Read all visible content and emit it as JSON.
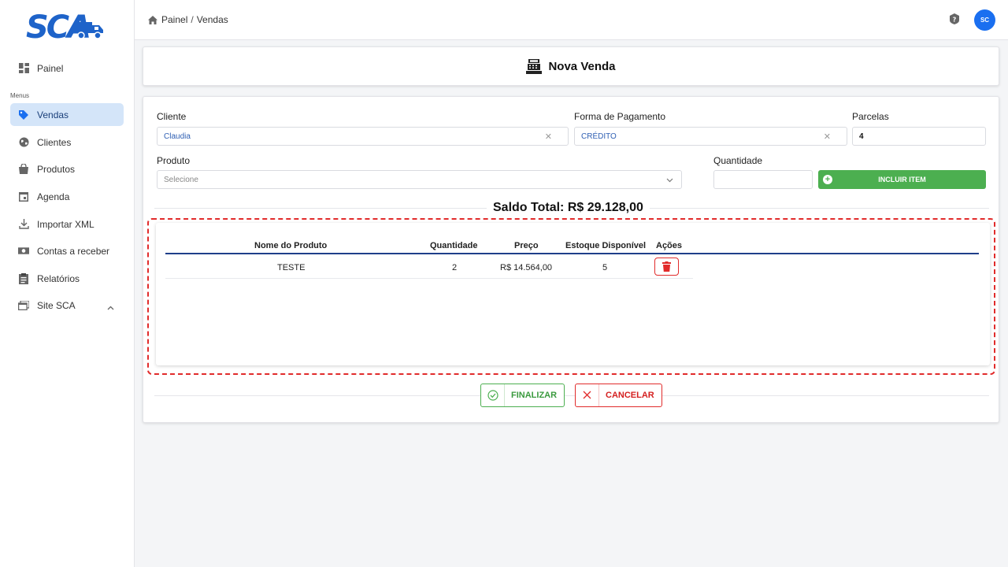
{
  "brand": {
    "logo_text": "SCA",
    "color": "#1e63c9"
  },
  "sidebar": {
    "section_label": "Menus",
    "items": [
      {
        "label": "Painel",
        "icon": "dashboard-icon"
      },
      {
        "label": "Vendas",
        "icon": "tag-icon",
        "active": true
      },
      {
        "label": "Clientes",
        "icon": "globe-icon"
      },
      {
        "label": "Produtos",
        "icon": "shopping-bag-icon"
      },
      {
        "label": "Agenda",
        "icon": "calendar-icon"
      },
      {
        "label": "Importar XML",
        "icon": "download-icon"
      },
      {
        "label": "Contas a receber",
        "icon": "money-icon"
      },
      {
        "label": "Relatórios",
        "icon": "clipboard-icon"
      },
      {
        "label": "Site SCA",
        "icon": "web-icon",
        "expanded": true
      }
    ]
  },
  "topbar": {
    "breadcrumb": [
      "Painel",
      "Vendas"
    ],
    "avatar_initials": "SC"
  },
  "page": {
    "title": "Nova Venda"
  },
  "form": {
    "cliente": {
      "label": "Cliente",
      "value": "Claudia"
    },
    "pagamento": {
      "label": "Forma de Pagamento",
      "value": "CRÉDITO"
    },
    "parcelas": {
      "label": "Parcelas",
      "value": "4"
    },
    "produto": {
      "label": "Produto",
      "placeholder": "Selecione"
    },
    "quantidade": {
      "label": "Quantidade",
      "value": ""
    },
    "add_button": "INCLUIR ITEM"
  },
  "saldo": "Saldo Total: R$ 29.128,00",
  "table": {
    "headers": [
      "Nome do Produto",
      "Quantidade",
      "Preço",
      "Estoque Disponível",
      "Ações"
    ],
    "rows": [
      {
        "nome": "TESTE",
        "quantidade": "2",
        "preco": "R$ 14.564,00",
        "estoque": "5"
      }
    ]
  },
  "actions": {
    "finalize": "FINALIZAR",
    "cancel": "CANCELAR"
  },
  "colors": {
    "primary": "#1a6ff0",
    "success": "#4caf50",
    "danger": "#e12b2b",
    "active_nav": "#d4e5f9"
  }
}
